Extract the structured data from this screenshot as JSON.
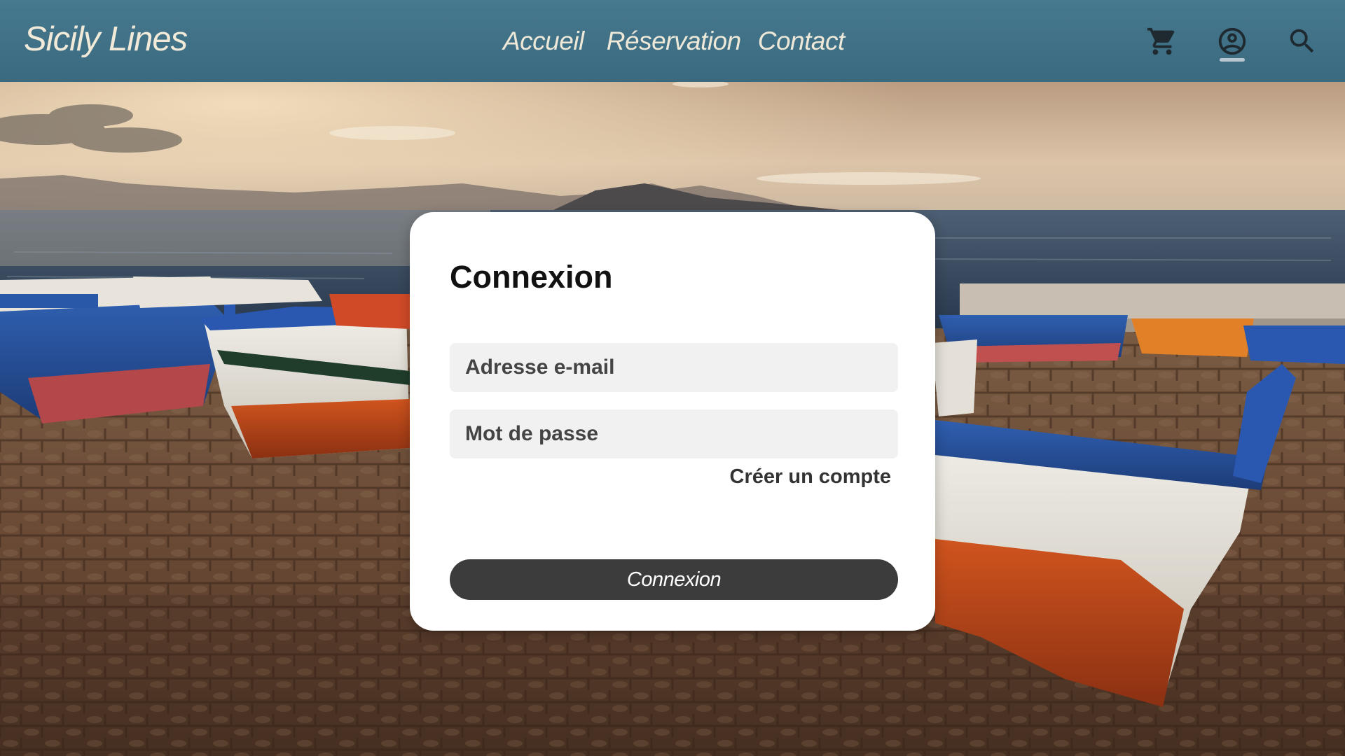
{
  "header": {
    "logo": "Sicily Lines",
    "nav": [
      {
        "label": "Accueil"
      },
      {
        "label": "Réservation"
      },
      {
        "label": "Contact"
      }
    ],
    "icons": [
      "cart-icon",
      "account-icon",
      "search-icon"
    ],
    "background_color": "#40728a"
  },
  "login": {
    "title": "Connexion",
    "email_placeholder": "Adresse e-mail",
    "password_placeholder": "Mot de passe",
    "create_account_label": "Créer un compte",
    "submit_label": "Connexion"
  },
  "colors": {
    "header": "#40728a",
    "logo_text": "#f2ead8",
    "card": "#ffffff",
    "button": "#3c3c3c",
    "field": "#f1f1f1"
  }
}
